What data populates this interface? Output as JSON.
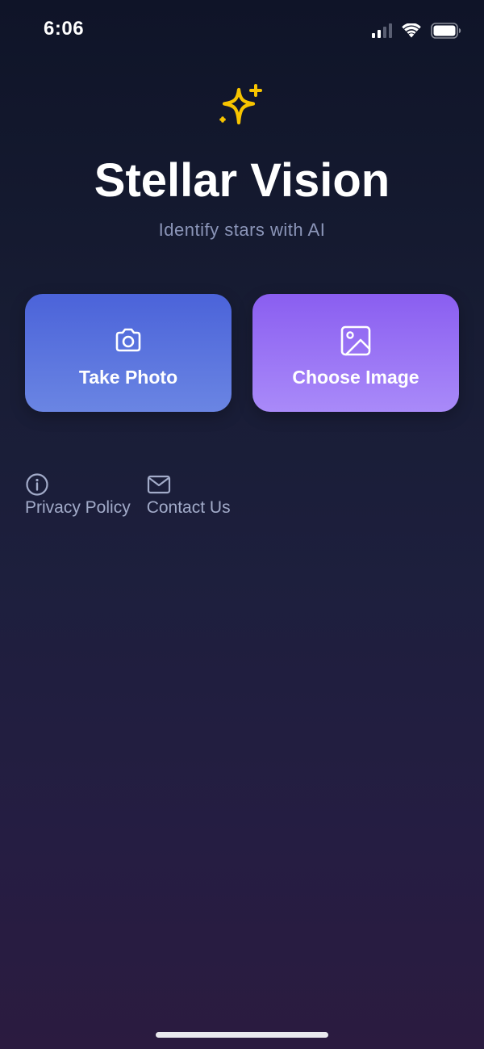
{
  "status_bar": {
    "time": "6:06",
    "signal_icon": "cellular-signal-icon",
    "wifi_icon": "wifi-icon",
    "battery_icon": "battery-icon"
  },
  "header": {
    "logo_icon": "sparkles-icon",
    "title": "Stellar Vision",
    "subtitle": "Identify stars with AI"
  },
  "actions": {
    "take_photo": {
      "label": "Take Photo",
      "icon": "camera-icon"
    },
    "choose_image": {
      "label": "Choose Image",
      "icon": "image-icon"
    }
  },
  "footer": {
    "privacy": {
      "label": "Privacy Policy",
      "icon": "info-icon"
    },
    "contact": {
      "label": "Contact Us",
      "icon": "mail-icon"
    }
  },
  "colors": {
    "accent_yellow": "#f7c400",
    "take_photo_top": "#4b63d9",
    "take_photo_bottom": "#6a85e3",
    "choose_image_top": "#8a5ef0",
    "choose_image_bottom": "#a98af9",
    "subtitle": "#8b95b8",
    "footer_text": "#a2abc9"
  }
}
